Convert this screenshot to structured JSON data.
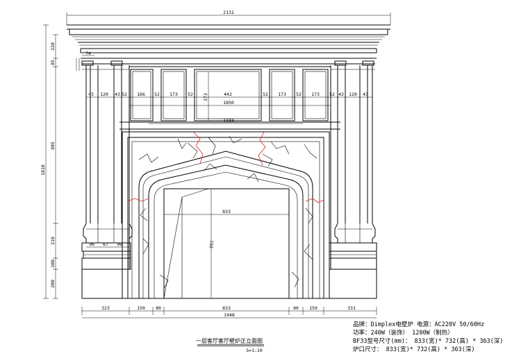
{
  "drawing": {
    "dims_top": {
      "overall": "2131",
      "small_74": "74",
      "panel_row": [
        "43",
        "120",
        "43",
        "52",
        "166",
        "52",
        "173",
        "52",
        "442",
        "52",
        "173",
        "52",
        "173",
        "52",
        "43",
        "120",
        "43"
      ],
      "span_1850": "1850",
      "span_1333": "1333",
      "opening": "833",
      "height_732": "732"
    },
    "dims_left": [
      "220",
      "85",
      "995",
      "210",
      "100",
      "200"
    ],
    "dim_total_height": "1810",
    "dim_373": "373",
    "dims_base_left": [
      "96",
      "67",
      "96"
    ],
    "dims_bottom": [
      "323",
      "150",
      "80",
      "833",
      "80",
      "150",
      "331"
    ],
    "dim_bottom_total": "1948",
    "caption": {
      "title": "一层客厅客厅壁炉正立面图",
      "scale": "S=1:10"
    },
    "specs": [
      "品牌：Dimplex电壁炉   电源：AC220V  50/60Hz",
      "功率：240W（装饰）  1200W（制热）",
      "BF33型号尺寸(mm)：  833(宽)* 732(高) * 363(深)",
      "炉口尺寸： 833(宽)* 732(高) * 363(深)"
    ]
  }
}
